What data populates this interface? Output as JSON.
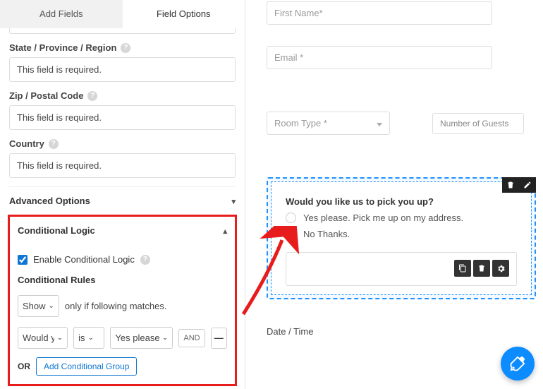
{
  "tabs": {
    "add_fields": "Add Fields",
    "field_options": "Field Options"
  },
  "fields": {
    "state": {
      "label": "State / Province / Region",
      "value": "This field is required."
    },
    "zip": {
      "label": "Zip / Postal Code",
      "value": "This field is required."
    },
    "country": {
      "label": "Country",
      "value": "This field is required."
    }
  },
  "sections": {
    "advanced": "Advanced Options",
    "conditional": "Conditional Logic"
  },
  "cond": {
    "enable": "Enable Conditional Logic",
    "rules_title": "Conditional Rules",
    "action": "Show",
    "match_text": "only if following matches.",
    "field_sel": "Would yo",
    "op": "is",
    "val_sel": "Yes please. Pic",
    "and": "AND",
    "or": "OR",
    "add_group": "Add Conditional Group"
  },
  "preview": {
    "first_name": "First Name*",
    "email": "Email *",
    "room_type": "Room Type *",
    "guests": "Number of Guests",
    "question": "Would you like us to pick you up?",
    "opt1": "Yes please. Pick me up on my address.",
    "opt2": "No Thanks.",
    "date": "Date / Time"
  }
}
